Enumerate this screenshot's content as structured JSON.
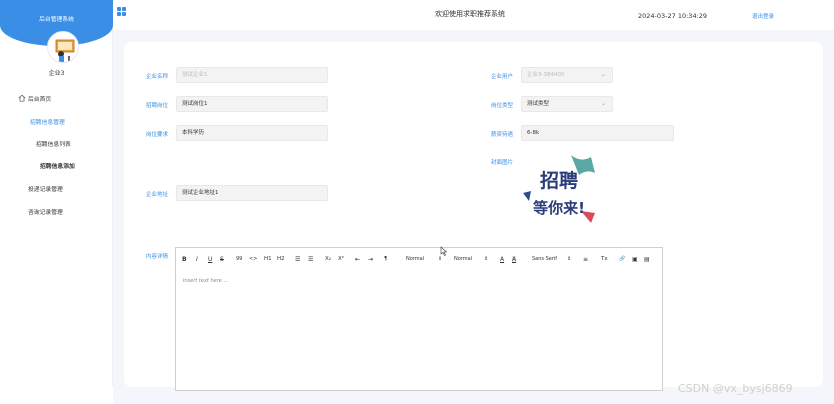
{
  "header": {
    "site_title": "欢迎使用求职推荐系统",
    "datetime": "2024-03-27 10:34:29",
    "logout": "退出登录"
  },
  "sidebar": {
    "system_title": "后台管理系统",
    "username": "企业3",
    "items": [
      {
        "label": "后台首页",
        "icon": "home-icon"
      },
      {
        "label": "招聘信息管理"
      },
      {
        "label": "招聘信息列表"
      },
      {
        "label": "招聘信息添加"
      },
      {
        "label": "投递记录管理"
      },
      {
        "label": "咨询记录管理"
      }
    ]
  },
  "form": {
    "company_name": {
      "label": "企业名称",
      "placeholder": "测试企业1"
    },
    "company_user": {
      "label": "企业用户",
      "placeholder": "企业3-384400"
    },
    "job_title": {
      "label": "招聘岗位",
      "value": "测试岗位1"
    },
    "job_type": {
      "label": "岗位类型",
      "value": "测试类型"
    },
    "job_requirement": {
      "label": "岗位要求",
      "value": "本科学历"
    },
    "salary": {
      "label": "薪资待遇",
      "value": "6-8k"
    },
    "cover_image": {
      "label": "封面图片",
      "image_text_line1": "招聘",
      "image_text_line2": "等你来!"
    },
    "company_address": {
      "label": "企业地址",
      "value": "测试企业地址1"
    },
    "content": {
      "label": "内容详情",
      "placeholder": "Insert text here ..."
    }
  },
  "editor_toolbar": {
    "bold": "B",
    "italic": "I",
    "underline": "U",
    "strike": "S",
    "quote": "99",
    "code": "<>",
    "h1": "H1",
    "h2": "H2",
    "ol": "☰",
    "ul": "☰",
    "sub": "X₂",
    "sup": "X²",
    "outdent": "⇤",
    "indent": "⇥",
    "direction": "¶",
    "size1": "Normal",
    "size2": "Normal",
    "color": "A",
    "background": "A",
    "font": "Sans Serif",
    "align": "≡",
    "clean": "Tx",
    "link": "🔗",
    "image": "▣",
    "video": "▤"
  },
  "watermark": "CSDN @vx_bysj6869",
  "colors": {
    "accent": "#3a8ee6",
    "panel_bg": "#f4f6fb"
  }
}
